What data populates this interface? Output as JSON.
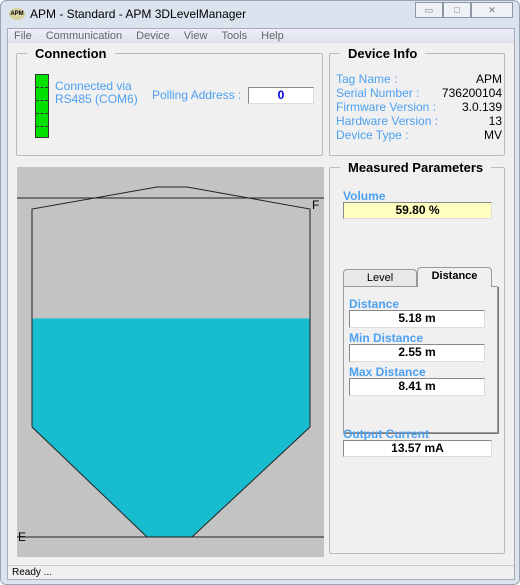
{
  "window": {
    "title": "APM - Standard - APM 3DLevelManager",
    "logo": "APM"
  },
  "menu": [
    "File",
    "Communication",
    "Device",
    "View",
    "Tools",
    "Help"
  ],
  "connection": {
    "title": "Connection",
    "status_line1": "Connected via",
    "status_line2": "RS485 (COM6)",
    "polling_label": "Polling Address :",
    "polling_value": "0"
  },
  "device_info": {
    "title": "Device Info",
    "rows": [
      {
        "label": "Tag Name :",
        "value": "APM"
      },
      {
        "label": "Serial Number :",
        "value": "736200104"
      },
      {
        "label": "Firmware Version :",
        "value": "3.0.139"
      },
      {
        "label": "Hardware Version :",
        "value": "13"
      },
      {
        "label": "Device Type :",
        "value": "MV"
      }
    ]
  },
  "tank": {
    "full_label": "F",
    "empty_label": "E",
    "fill_percent": 59.8,
    "liquid_color": "#17bccf"
  },
  "measured": {
    "title": "Measured Parameters",
    "volume_label": "Volume",
    "volume_value": "59.80 %",
    "tabs": [
      "Level",
      "Distance"
    ],
    "active_tab": "Distance",
    "distance_label": "Distance",
    "distance_value": "5.18 m",
    "min_label": "Min Distance",
    "min_value": "2.55 m",
    "max_label": "Max Distance",
    "max_value": "8.41 m",
    "current_label": "Output Current",
    "current_value": "13.57 mA"
  },
  "status": "Ready ..."
}
